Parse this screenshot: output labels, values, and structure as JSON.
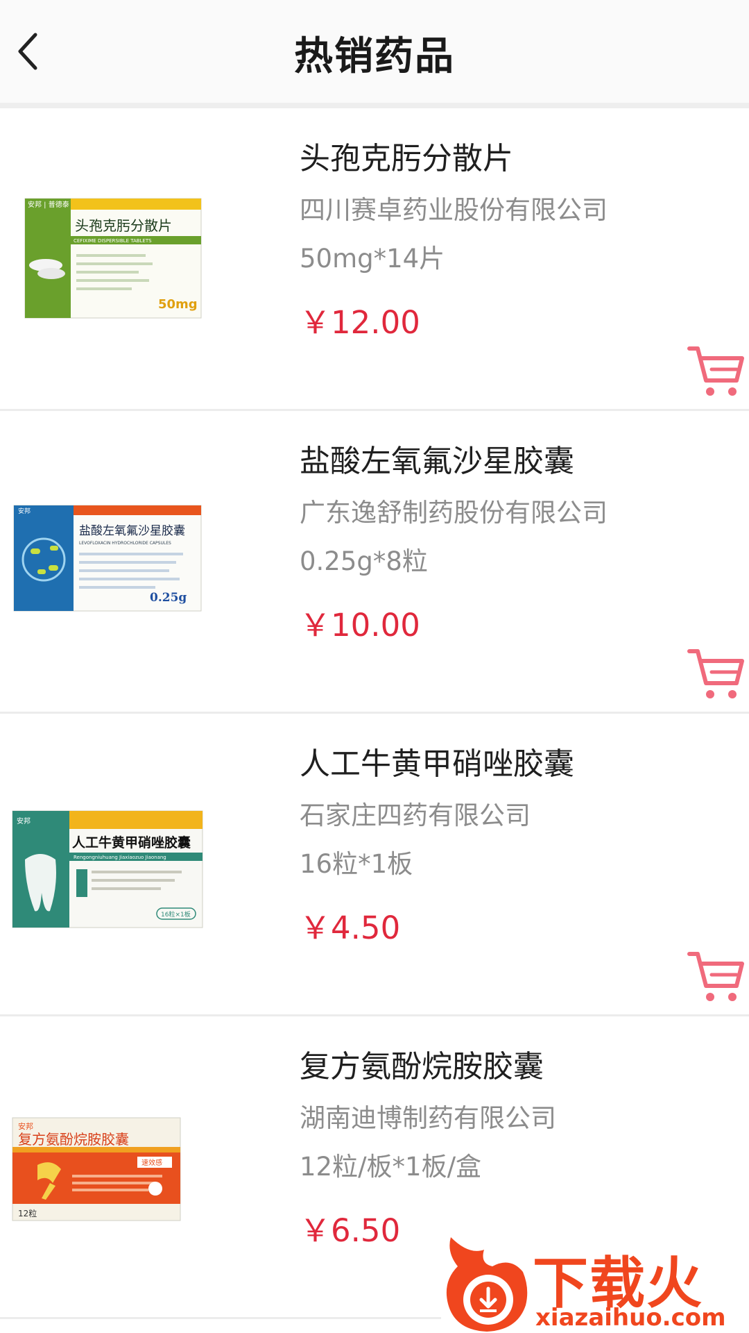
{
  "header": {
    "title": "热销药品",
    "back_icon": "chevron-left-icon"
  },
  "products": [
    {
      "name": "头孢克肟分散片",
      "maker": "四川赛卓药业股份有限公司",
      "spec": "50mg*14片",
      "price": "￥12.00",
      "box": {
        "brand": "安邦 | 普德泰",
        "title": "头孢克肟分散片",
        "subtitle": "CEFIXIME DISPERSIBLE TABLETS",
        "dose": "50mg"
      },
      "colors": {
        "box_panel": "#6aa02c",
        "box_stripe": "#f2c21b"
      }
    },
    {
      "name": "盐酸左氧氟沙星胶囊",
      "maker": "广东逸舒制药股份有限公司",
      "spec": "0.25g*8粒",
      "price": "￥10.00",
      "box": {
        "brand": "安邦",
        "title": "盐酸左氧氟沙星胶囊",
        "subtitle": "LEVOFLOXACIN HYDROCHLORIDE CAPSULES",
        "dose": "0.25g"
      },
      "colors": {
        "box_panel": "#1f6fb0",
        "box_stripe": "#e8551d"
      }
    },
    {
      "name": "人工牛黄甲硝唑胶囊",
      "maker": "石家庄四药有限公司",
      "spec": "16粒*1板",
      "price": "￥4.50",
      "box": {
        "brand": "安邦",
        "title": "人工牛黄甲硝唑胶囊",
        "subtitle": "Rengongniuhuang Jiaxiaozuo Jiaonang",
        "dose": "16粒×1板"
      },
      "colors": {
        "box_panel": "#2f8a78",
        "box_stripe": "#f2b41b"
      }
    },
    {
      "name": "复方氨酚烷胺胶囊",
      "maker": "湖南迪博制药有限公司",
      "spec": "12粒/板*1板/盒",
      "price": "￥6.50",
      "box": {
        "brand": "安邦",
        "title": "复方氨酚烷胺胶囊",
        "subtitle": "速效感",
        "dose": "12粒"
      },
      "colors": {
        "box_panel": "#e8501e",
        "box_stripe": "#f0a020"
      }
    }
  ],
  "cart_icon": "shopping-cart-icon",
  "watermark": {
    "text": "下载火",
    "url": "xiazaihuo.com",
    "logo_icon": "flame-logo-icon"
  },
  "colors": {
    "price": "#e0283c",
    "cart": "#f06a7c",
    "watermark": "#f0461e"
  }
}
